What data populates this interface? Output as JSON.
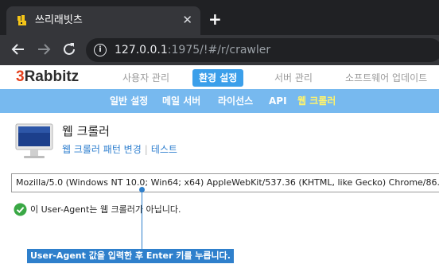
{
  "browser": {
    "tab_title": "쓰리래빗츠",
    "tab_close": "✕",
    "new_tab": "+",
    "url_host": "127.0.0.1",
    "url_rest": ":1975/!#/r/crawler"
  },
  "app": {
    "logo_prefix": "3",
    "logo_name": "Rabbitz",
    "main_nav": [
      "사용자 관리",
      "환경 설정",
      "서버 관리",
      "소프트웨어 업데이트"
    ],
    "main_nav_active": "환경 설정",
    "sub_nav": [
      "일반 설정",
      "메일 서버",
      "라이선스",
      "API",
      "웹 크롤러"
    ],
    "sub_nav_active": "웹 크롤러"
  },
  "page": {
    "title": "웹 크롤러",
    "links": [
      "웹 크롤러 패턴 변경",
      "테스트"
    ],
    "user_agent_value": "Mozilla/5.0 (Windows NT 10.0; Win64; x64) AppleWebKit/537.36 (KHTML, like Gecko) Chrome/86.",
    "status_message": "이 User-Agent는 웹 크롤러가 아닙니다.",
    "callout": "User-Agent 값을 입력한 후 Enter 키를 누릅니다."
  },
  "colors": {
    "accent": "#3b9fea",
    "subnav_bg": "#77b9ef",
    "subnav_active": "#fff36b",
    "status_ok": "#3aa845",
    "callout": "#2f80cc"
  },
  "icons": {
    "favicon": "rabbit-favicon-icon",
    "back": "back-arrow-icon",
    "forward": "forward-arrow-icon",
    "reload": "reload-icon",
    "info": "info-icon",
    "monitor": "monitor-icon",
    "status": "check-circle-icon"
  }
}
